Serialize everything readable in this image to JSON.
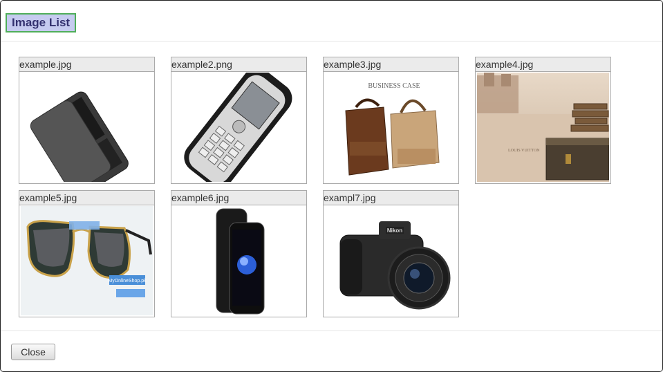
{
  "dialog": {
    "title": "Image List",
    "close_label": "Close"
  },
  "images": [
    {
      "caption": "example.jpg",
      "icon": "smartphone-image"
    },
    {
      "caption": "example2.png",
      "icon": "cellphone-image"
    },
    {
      "caption": "example3.jpg",
      "icon": "bags-image",
      "overlay_text": "BUSINESS CASE"
    },
    {
      "caption": "example4.jpg",
      "icon": "trunk-image",
      "overlay_text": "LOUIS VUITTON"
    },
    {
      "caption": "example5.jpg",
      "icon": "sunglasses-image",
      "overlay_text": "MyOnlineShop.pk"
    },
    {
      "caption": "example6.jpg",
      "icon": "iphone-image"
    },
    {
      "caption": "exampl7.jpg",
      "icon": "camera-image",
      "overlay_text": "Nikon"
    }
  ],
  "colors": {
    "title_bg": "#c6cbf0",
    "title_border": "#4fae5a",
    "title_text": "#33316f"
  }
}
